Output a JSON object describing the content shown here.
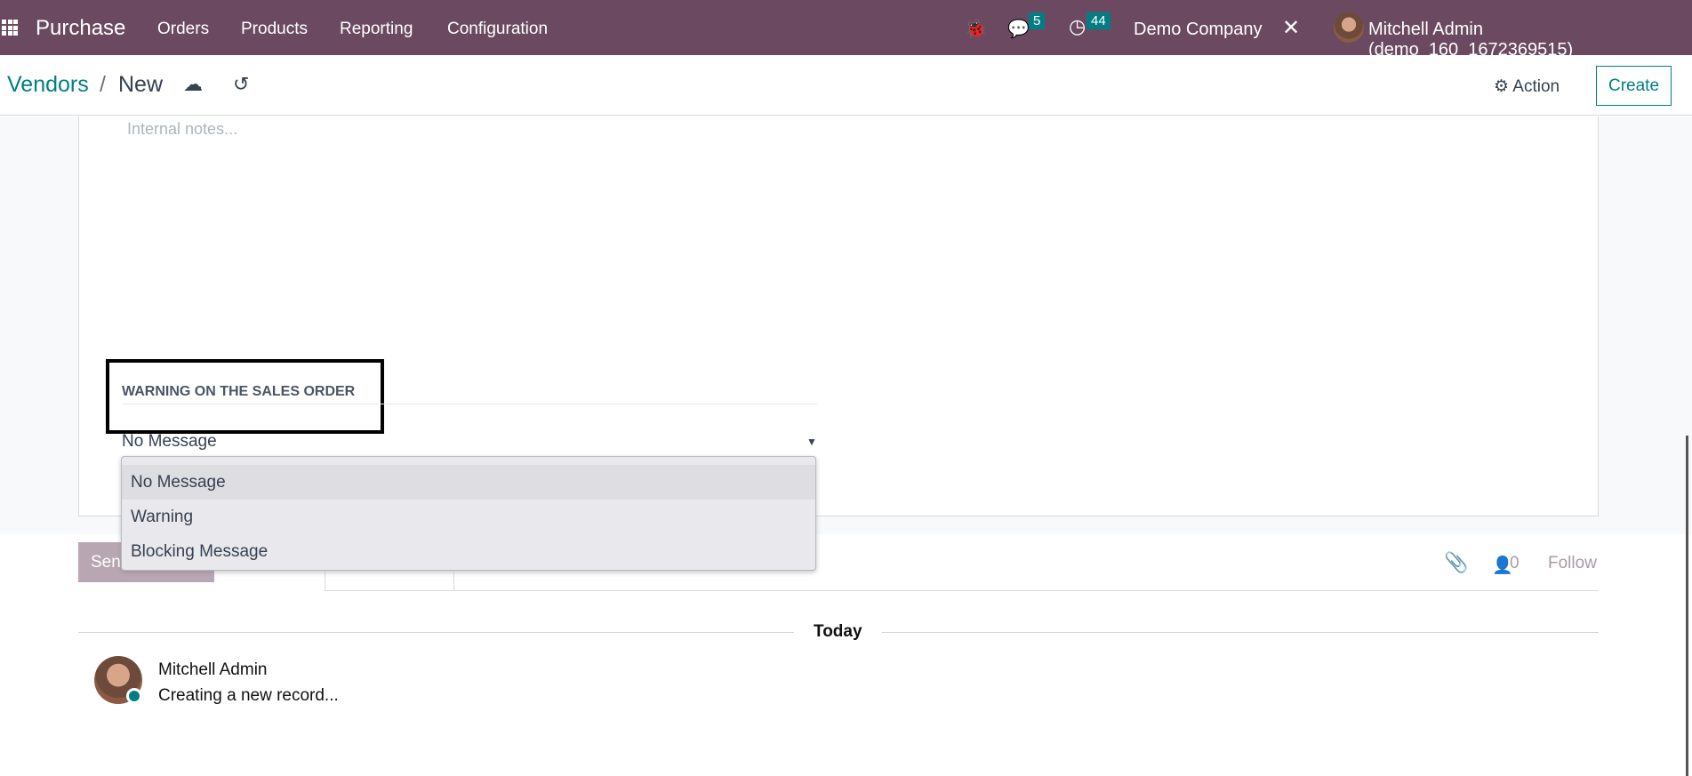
{
  "navbar": {
    "app": "Purchase",
    "menu": [
      "Orders",
      "Products",
      "Reporting",
      "Configuration"
    ],
    "messages_count": "5",
    "activities_count": "44",
    "company": "Demo Company",
    "user": "Mitchell Admin (demo_160_1672369515)",
    "color": "#6b4a61"
  },
  "breadcrumb": {
    "parent": "Vendors",
    "separator": "/",
    "current": "New"
  },
  "controls": {
    "action": "Action",
    "create": "Create"
  },
  "form": {
    "notes_placeholder": "Internal notes...",
    "warning_label": "WARNING ON THE SALES ORDER",
    "warning_value": "No Message",
    "options": [
      "No Message",
      "Warning",
      "Blocking Message"
    ]
  },
  "chatter": {
    "send_message": "Send message",
    "followers": "0",
    "follow": "Follow",
    "date_separator": "Today",
    "message": {
      "author": "Mitchell Admin",
      "body": "Creating a new record..."
    }
  }
}
